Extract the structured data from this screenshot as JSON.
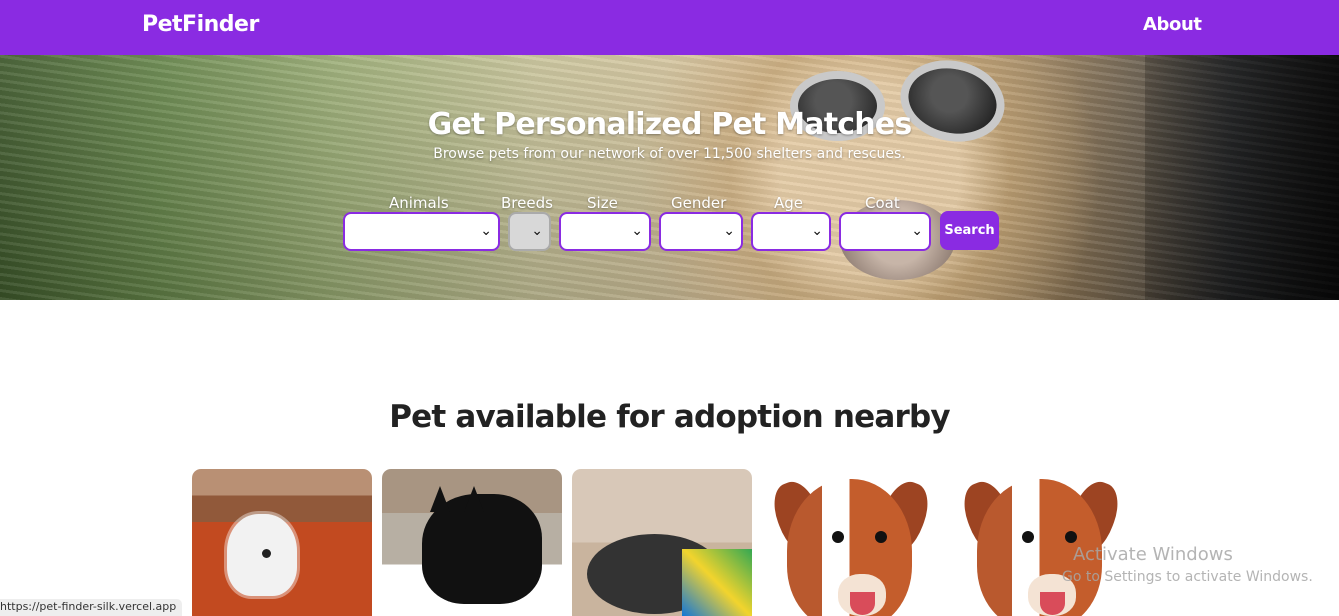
{
  "navbar": {
    "brand": "PetFinder",
    "about_link": "About",
    "background": "#8a2be2"
  },
  "hero": {
    "title": "Get Personalized Pet Matches",
    "subtitle": "Browse pets from our network of over 11,500 shelters and rescues.",
    "filters": [
      {
        "label": "Animals",
        "selected": "",
        "disabled": false
      },
      {
        "label": "Breeds",
        "selected": "",
        "disabled": true
      },
      {
        "label": "Size",
        "selected": "",
        "disabled": false
      },
      {
        "label": "Gender",
        "selected": "",
        "disabled": false
      },
      {
        "label": "Age",
        "selected": "",
        "disabled": false
      },
      {
        "label": "Coat",
        "selected": "",
        "disabled": false
      }
    ],
    "search_button": "Search",
    "accent_color": "#8a2be2"
  },
  "main": {
    "section_title": "Pet available for adoption nearby",
    "cards": [
      {
        "image": "white rabbit on orange blanket"
      },
      {
        "image": "black cat on white surface"
      },
      {
        "image": "black dog on colorful blanket"
      },
      {
        "image": "brown and white puppy"
      },
      {
        "image": "brown and white puppy"
      }
    ]
  },
  "overlay": {
    "windows_title": "Activate Windows",
    "windows_subtitle": "Go to Settings to activate Windows.",
    "status_url": "https://pet-finder-silk.vercel.app"
  },
  "icons": {
    "select_arrow": "chevron-down-icon"
  }
}
